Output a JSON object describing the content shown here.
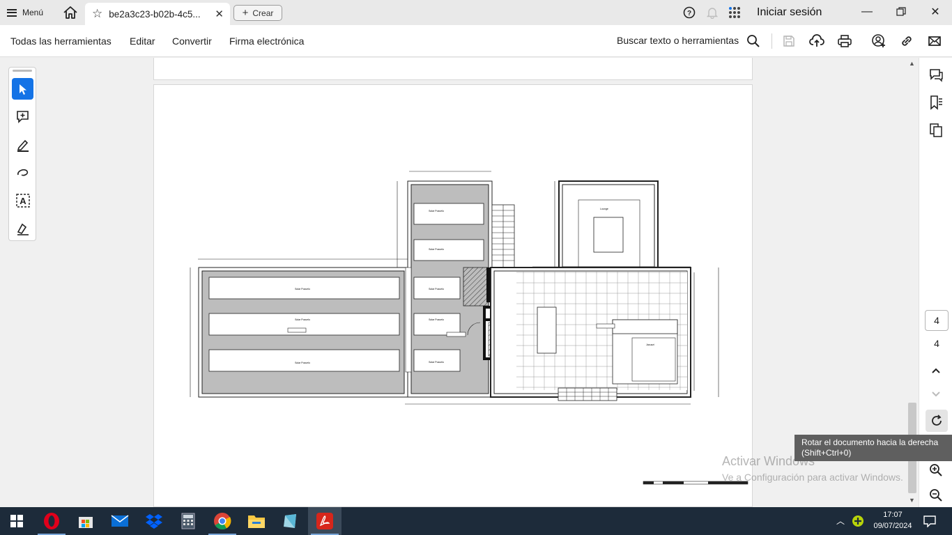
{
  "titlebar": {
    "menu_label": "Menú",
    "tab_title": "be2a3c23-b02b-4c5...",
    "create_label": "Crear",
    "signin_label": "Iniciar sesión"
  },
  "toolbar": {
    "items": [
      "Todas las herramientas",
      "Editar",
      "Convertir",
      "Firma electrónica"
    ],
    "search_label": "Buscar texto o herramientas"
  },
  "left_rail": {
    "tools": [
      "select-tool",
      "add-comment-tool",
      "highlight-tool",
      "draw-tool",
      "text-recognition-tool",
      "fill-sign-tool"
    ]
  },
  "right_rail": {
    "current_page": "4",
    "total_pages": "4"
  },
  "tooltip": {
    "line1": "Rotar el documento hacia la derecha",
    "line2": "(Shift+Ctrl+0)"
  },
  "watermark": {
    "line1": "Activar Windows",
    "line2": "Ve a Configuración para activar Windows."
  },
  "floorplan": {
    "room_labels": {
      "left_1": "Solar Pozuelo",
      "left_2": "Solar Pozuelo",
      "left_3": "Solar Pozuelo",
      "mid_1": "Solar Pozuelo",
      "mid_2": "Solar Pozuelo",
      "mid_3": "Solar Pozuelo",
      "mid_4": "Solar Pozuelo",
      "mid_5": "Solar Pozuelo",
      "lounge": "Lounge",
      "jacuzzi": "Jacuzzi",
      "barbacoa": "Barbacoa"
    }
  },
  "taskbar": {
    "time": "17:07",
    "date": "09/07/2024"
  }
}
